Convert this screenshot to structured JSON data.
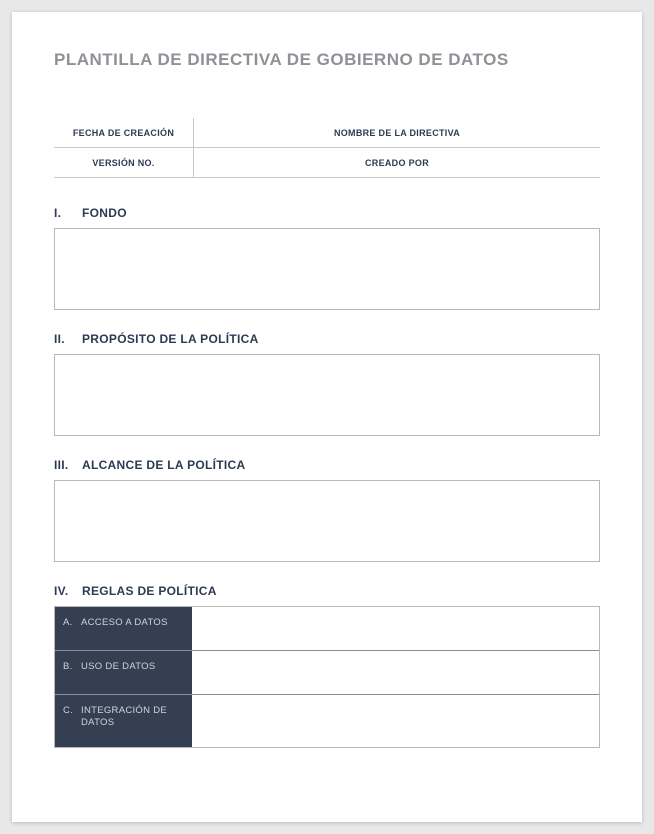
{
  "title": "PLANTILLA DE DIRECTIVA DE GOBIERNO DE DATOS",
  "meta": {
    "row1": {
      "left": "FECHA DE CREACIÓN",
      "right": "NOMBRE DE LA DIRECTIVA"
    },
    "row2": {
      "left": "VERSIÓN NO.",
      "right": "CREADO POR"
    }
  },
  "sections": {
    "s1": {
      "num": "I.",
      "label": "FONDO"
    },
    "s2": {
      "num": "II.",
      "label": "PROPÓSITO DE LA POLÍTICA"
    },
    "s3": {
      "num": "III.",
      "label": "ALCANCE DE LA POLÍTICA"
    },
    "s4": {
      "num": "IV.",
      "label": "REGLAS DE POLÍTICA"
    }
  },
  "rules": {
    "r1": {
      "letter": "A.",
      "label": "ACCESO A DATOS"
    },
    "r2": {
      "letter": "B.",
      "label": "USO DE DATOS"
    },
    "r3": {
      "letter": "C.",
      "label": "INTEGRACIÓN DE DATOS"
    }
  }
}
